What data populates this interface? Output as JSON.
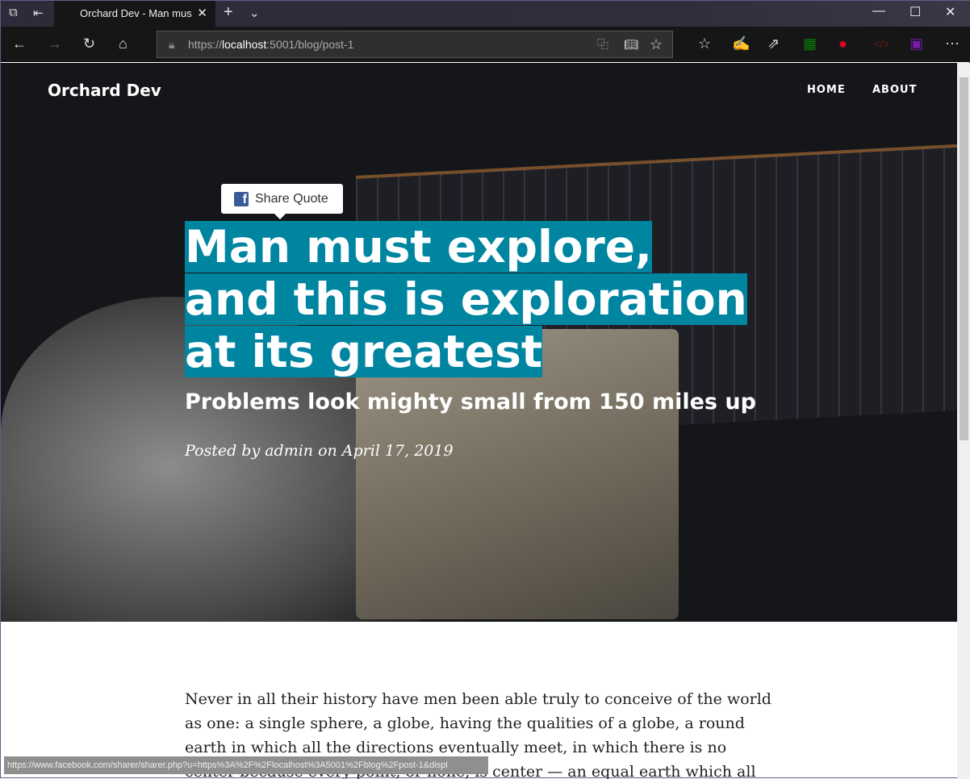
{
  "browser": {
    "tab_title": "Orchard Dev - Man mus",
    "url_prefix": "https://",
    "url_host": "localhost",
    "url_rest": ":5001/blog/post-1",
    "status_url": "https://www.facebook.com/sharer/sharer.php?u=https%3A%2F%2Flocalhost%3A5001%2Fblog%2Fpost-1&displ"
  },
  "site": {
    "brand": "Orchard Dev",
    "nav": [
      "HOME",
      "ABOUT"
    ]
  },
  "share": {
    "label": "Share Quote"
  },
  "post": {
    "title": "Man must explore, and this is exploration at its greatest",
    "subtitle": "Problems look mighty small from 150 miles up",
    "meta": "Posted by admin on April 17, 2019",
    "body": "Never in all their history have men been able truly to conceive of the world as one: a single sphere, a globe, having the qualities of a globe, a round earth in which all the directions eventually meet, in which there is no center because every point, or none, is center — an equal earth which all men occupy as"
  }
}
